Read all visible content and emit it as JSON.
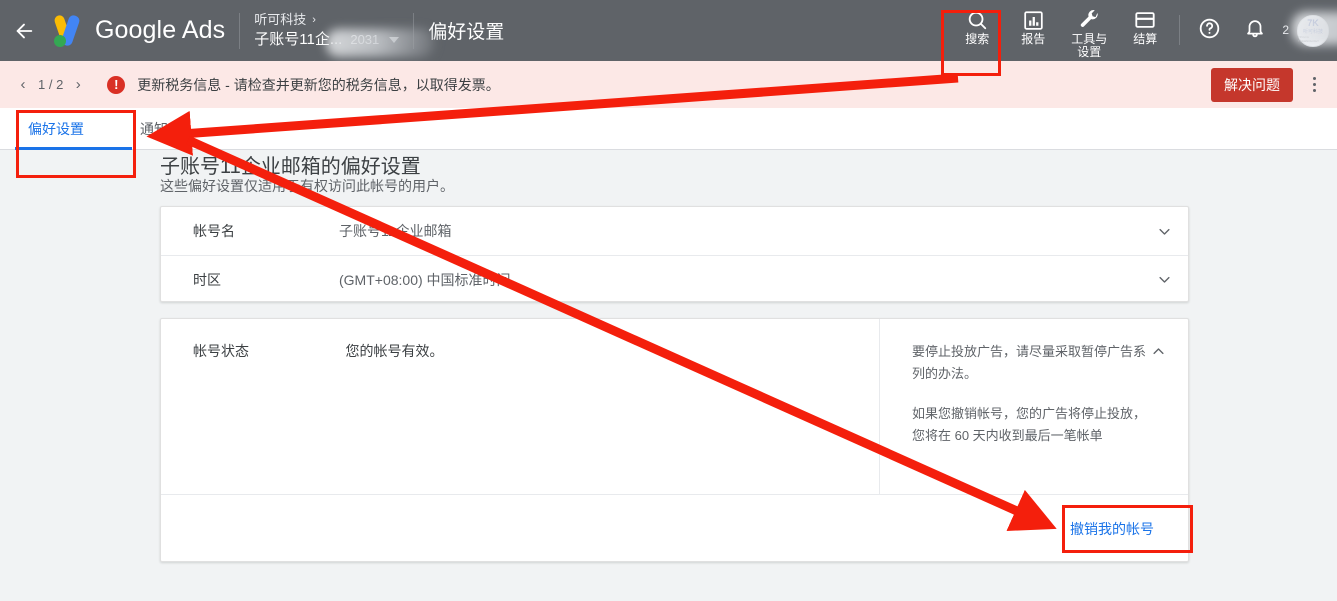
{
  "header": {
    "back_icon": "back-arrow-icon",
    "brand": "Google Ads",
    "account": {
      "parent": "听可科技",
      "separator": "›",
      "name": "子账号11企...",
      "id": "2031"
    },
    "page_title": "偏好设置",
    "actions": [
      {
        "icon": "search-icon",
        "label": "搜索"
      },
      {
        "icon": "reports-bar-chart-icon",
        "label": "报告"
      },
      {
        "icon": "tools-wrench-icon",
        "label": "工具与\n设置",
        "label_line1": "工具与",
        "label_line2": "设置"
      },
      {
        "icon": "billing-card-icon",
        "label": "结算"
      }
    ],
    "help_icon": "help-question-icon",
    "notifications_icon": "bell-icon",
    "user_label": "2",
    "avatar": {
      "line1": "7K",
      "line2": "听可科技",
      "line3": "TINGKE TECHNOLOGY"
    }
  },
  "notification": {
    "page_current": "1 / 2",
    "prev_icon": "chevron-left-icon",
    "next_icon": "chevron-right-icon",
    "alert_icon": "alert-exclamation-icon",
    "message": "更新税务信息 - 请检查并更新您的税务信息，以取得发票。",
    "action_label": "解决问题",
    "overflow_icon": "more-vert-icon"
  },
  "tabs": [
    {
      "label": "偏好设置",
      "active": true
    },
    {
      "label": "通知",
      "active": false
    }
  ],
  "main": {
    "heading": "子账号11企业邮箱的偏好设置",
    "subheading": "这些偏好设置仅适用于有权访问此帐号的用户。",
    "basic_rows": [
      {
        "label": "帐号名",
        "value": "子账号11企业邮箱",
        "expand_icon": "chevron-down-icon"
      },
      {
        "label": "时区",
        "value": "(GMT+08:00) 中国标准时间",
        "expand_icon": "chevron-down-icon"
      }
    ],
    "status": {
      "label": "帐号状态",
      "value": "您的帐号有效。",
      "collapse_icon": "chevron-up-icon",
      "notes": [
        "要停止投放广告，请尽量采取暂停广告系列的办法。",
        "如果您撤销帐号，您的广告将停止投放，您将在 60 天内收到最后一笔帐单"
      ],
      "cancel_link": "撤销我的帐号"
    }
  },
  "annotations": {
    "color": "#f41f0c",
    "boxes": [
      "tools-and-settings",
      "preferences-tab",
      "cancel-account-link"
    ],
    "arrows": [
      "tools-to-preferences-tab",
      "preferences-tab-to-cancel-link"
    ]
  },
  "colors": {
    "header_bg": "#5f6368",
    "notification_bg": "#fce8e6",
    "page_bg": "#f1f3f4",
    "accent_blue": "#1a73e8",
    "danger_red": "#c5372c",
    "annotation_red": "#f41f0c"
  }
}
